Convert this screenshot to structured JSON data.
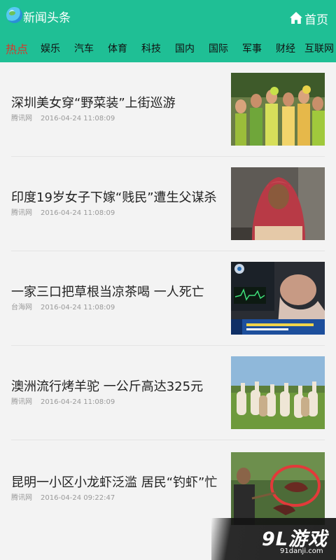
{
  "header": {
    "title": "新闻头条",
    "home_label": "首页"
  },
  "tabs": [
    "热点",
    "娱乐",
    "汽车",
    "体育",
    "科技",
    "国内",
    "国际",
    "军事",
    "财经",
    "互联网"
  ],
  "active_tab": 0,
  "articles": [
    {
      "title": "深圳美女穿“野菜装”上街巡游",
      "source": "腾讯网",
      "time": "2016-04-24 11:08:09",
      "image": "costume-parade-photo"
    },
    {
      "title": "印度19岁女子下嫁“贱民”遭生父谋杀",
      "source": "腾讯网",
      "time": "2016-04-24 11:08:09",
      "image": "woman-portrait-photo"
    },
    {
      "title": "一家三口把草根当凉茶喝 一人死亡",
      "source": "台海网",
      "time": "2016-04-24 11:08:09",
      "image": "hospital-news-photo"
    },
    {
      "title": "澳洲流行烤羊驼 一公斤高达325元",
      "source": "腾讯网",
      "time": "2016-04-24 11:08:09",
      "image": "alpaca-herd-photo"
    },
    {
      "title": "昆明一小区小龙虾泛滥 居民“钓虾”忙",
      "source": "腾讯网",
      "time": "2016-04-24 09:22:47",
      "image": "crayfish-catch-photo"
    }
  ],
  "watermark": {
    "logo": "9L游戏",
    "url": "91danji.com"
  },
  "colors": {
    "brand": "#1fbf95",
    "active_tab": "#d6382b"
  }
}
